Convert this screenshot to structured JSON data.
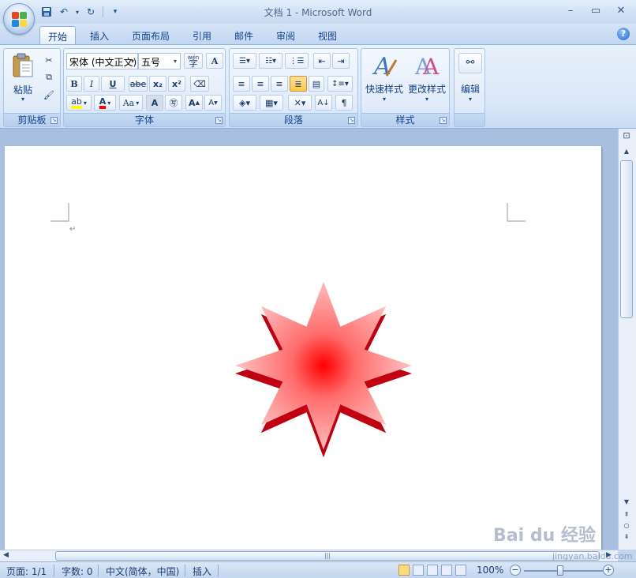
{
  "window": {
    "title": "文档 1 - Microsoft Word",
    "controls": [
      "minimize",
      "maximize",
      "close"
    ]
  },
  "quick_access": {
    "items": [
      "save-icon",
      "undo-icon",
      "redo-icon",
      "customize-icon"
    ]
  },
  "tabs": [
    {
      "label": "开始",
      "active": true
    },
    {
      "label": "插入"
    },
    {
      "label": "页面布局"
    },
    {
      "label": "引用"
    },
    {
      "label": "邮件"
    },
    {
      "label": "审阅"
    },
    {
      "label": "视图"
    }
  ],
  "ribbon": {
    "clipboard": {
      "label": "剪贴板",
      "paste_label": "粘贴"
    },
    "font": {
      "label": "字体",
      "font_name": "宋体 (中文正文)",
      "font_size": "五号",
      "bold": "B",
      "italic": "I",
      "underline": "U",
      "strike": "abe",
      "subscript": "x₂",
      "superscript": "x²",
      "change_case": "Aa",
      "char_border": "A",
      "grow": "A",
      "shrink": "A",
      "font_color": "A",
      "highlight": "ab",
      "phonetic": "wén",
      "enclose": "字"
    },
    "paragraph": {
      "label": "段落"
    },
    "styles": {
      "label": "样式",
      "quick_styles": "快速样式",
      "change_styles": "更改样式"
    },
    "editing": {
      "label": "编辑"
    }
  },
  "document": {
    "paragraph_mark": "↵"
  },
  "status": {
    "page": "页面: 1/1",
    "words": "字数: 0",
    "language": "中文(简体，中国)",
    "mode": "插入",
    "zoom": "100%"
  },
  "watermark": {
    "brand": "Bai du 经验",
    "url": "jingyan.baidu.com"
  },
  "colors": {
    "star_center": "#ff0000",
    "star_edge": "#ffc6c6",
    "star_side": "#c00010",
    "ribbon_text": "#15428b"
  }
}
